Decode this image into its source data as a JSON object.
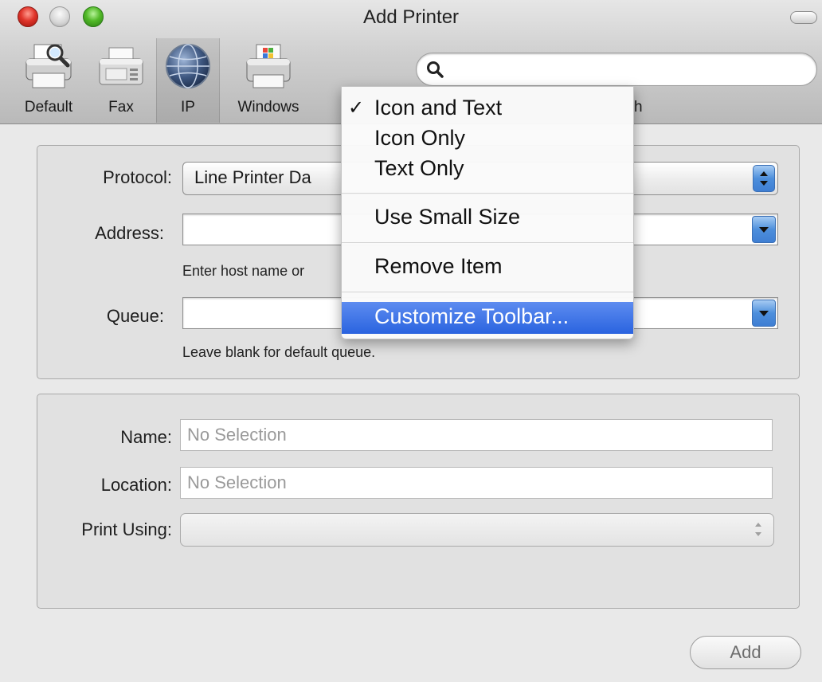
{
  "window": {
    "title": "Add Printer"
  },
  "toolbar": {
    "items": [
      {
        "label": "Default",
        "icon": "default-printer-icon"
      },
      {
        "label": "Fax",
        "icon": "fax-icon"
      },
      {
        "label": "IP",
        "icon": "ip-globe-icon",
        "selected": true
      },
      {
        "label": "Windows",
        "icon": "windows-printer-icon"
      }
    ],
    "search_label_partial": "h",
    "search_placeholder": ""
  },
  "context_menu": {
    "items": [
      {
        "label": "Icon and Text",
        "checked": true,
        "check_glyph": "✓"
      },
      {
        "label": "Icon Only"
      },
      {
        "label": "Text Only"
      },
      {
        "label": "Use Small Size"
      },
      {
        "label": "Remove Item"
      },
      {
        "label": "Customize Toolbar...",
        "highlighted": true
      }
    ]
  },
  "connection": {
    "protocol_label": "Protocol:",
    "protocol_value": "Line Printer Da",
    "address_label": "Address:",
    "address_value": "",
    "address_hint": "Enter host name or",
    "queue_label": "Queue:",
    "queue_value": "",
    "queue_hint": "Leave blank for default queue."
  },
  "info": {
    "name_label": "Name:",
    "name_placeholder": "No Selection",
    "location_label": "Location:",
    "location_placeholder": "No Selection",
    "print_using_label": "Print Using:",
    "print_using_value": ""
  },
  "buttons": {
    "add": "Add"
  },
  "colors": {
    "highlight": "#2a63df",
    "close": "#e0352b",
    "minimize": "#d4d4d4",
    "zoom": "#52b928"
  }
}
